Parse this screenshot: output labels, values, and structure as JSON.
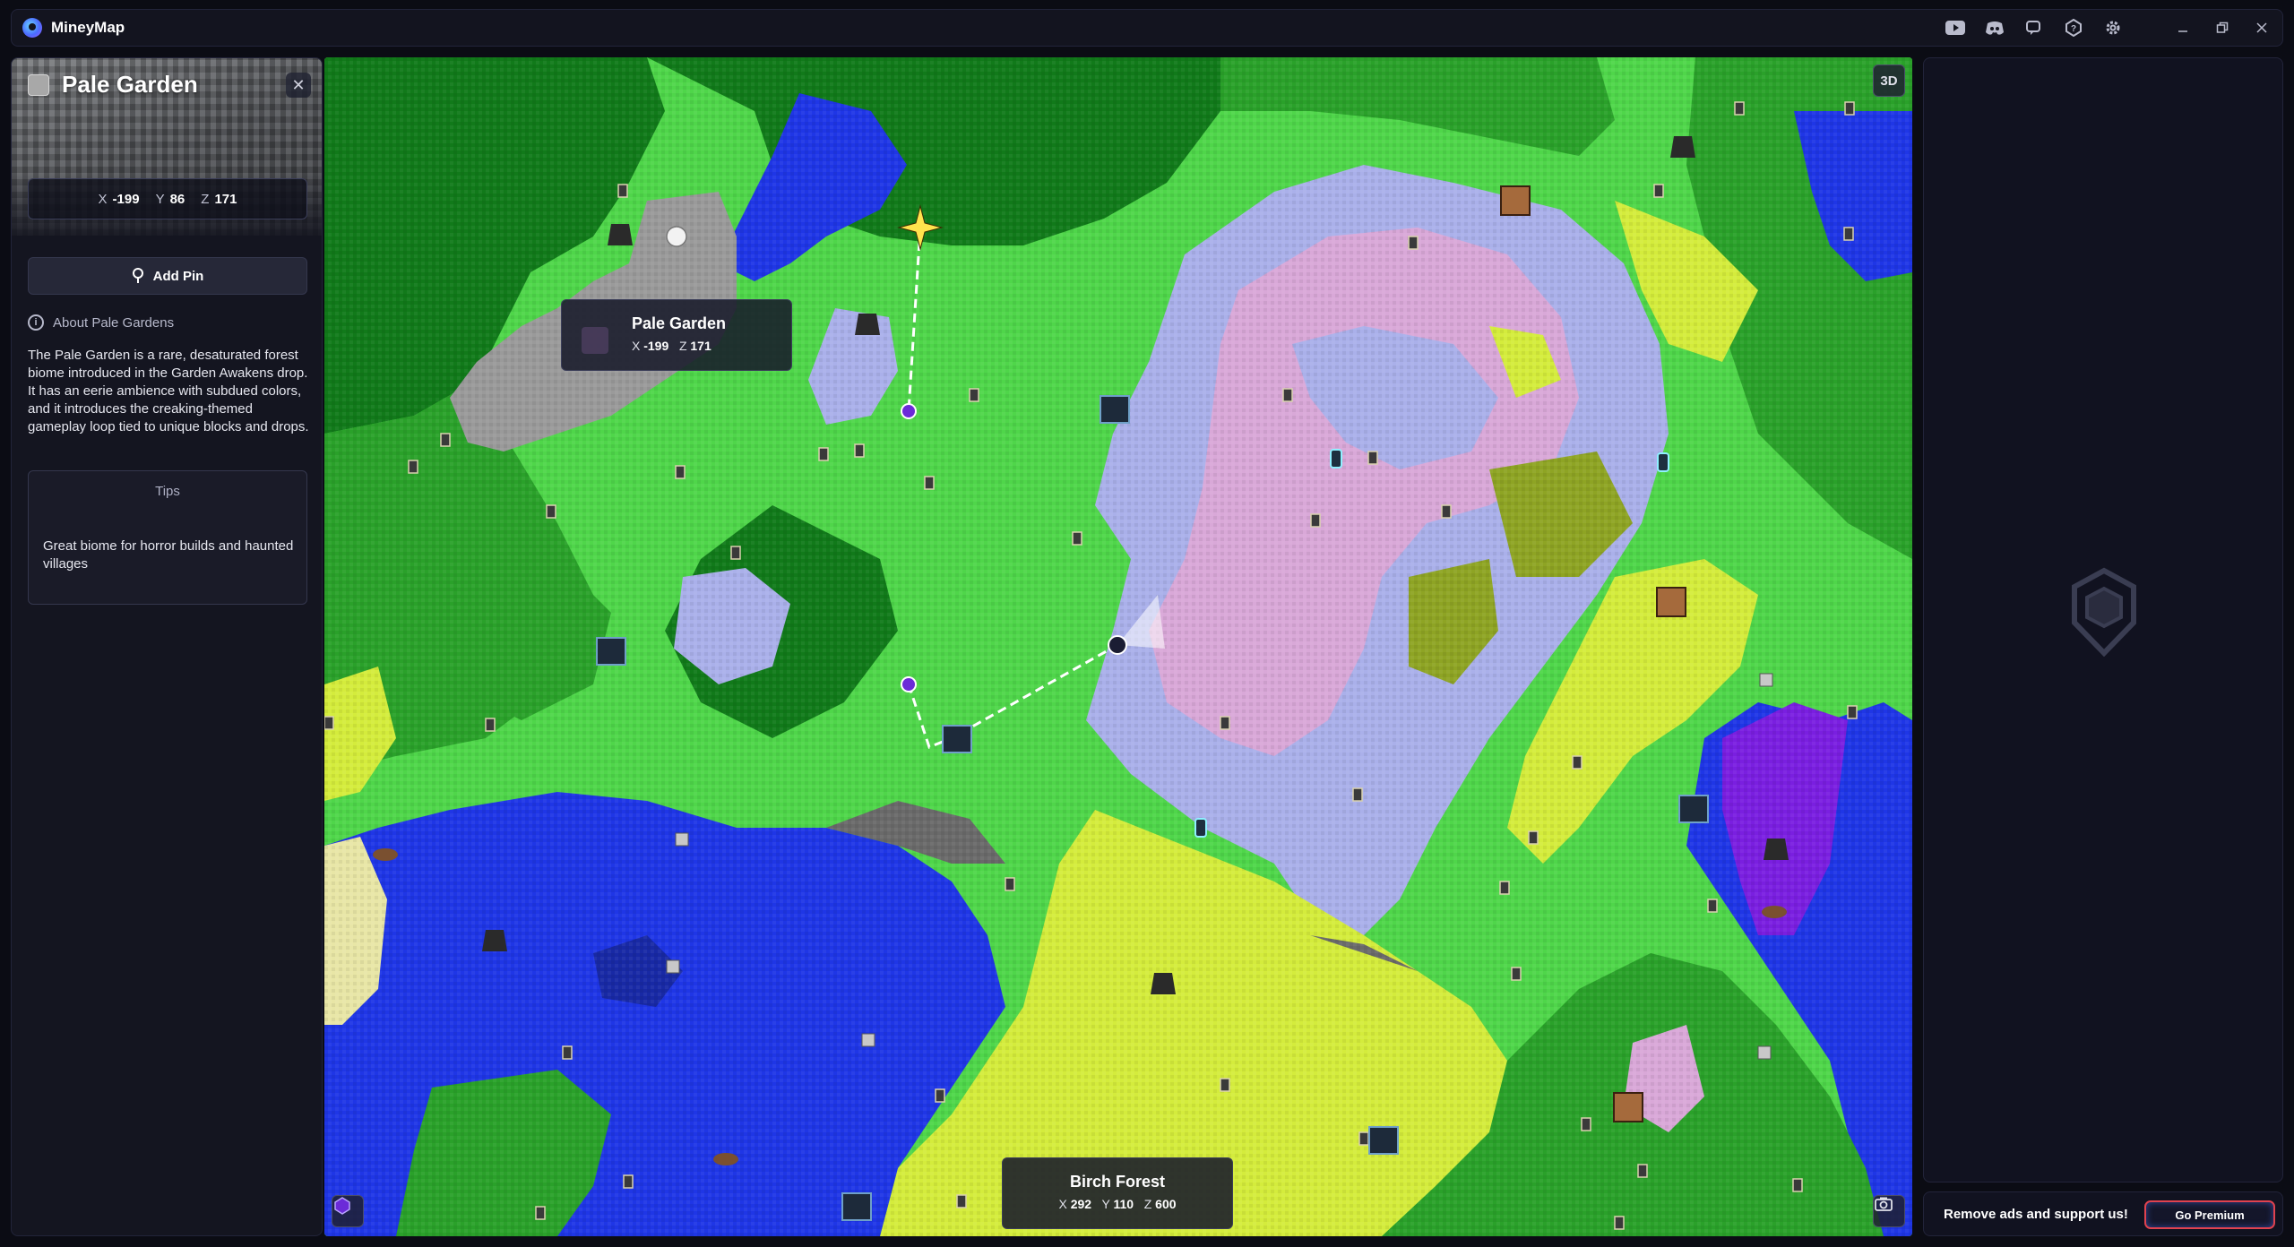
{
  "app": {
    "title": "MineyMap"
  },
  "titlebar_icons": [
    "youtube-icon",
    "discord-icon",
    "megaphone-icon",
    "help-icon",
    "settings-icon",
    "minimize-icon",
    "restore-icon",
    "close-icon"
  ],
  "panel": {
    "biome_name": "Pale Garden",
    "swatch_color": "#a8a8a8",
    "coords": {
      "x_label": "X",
      "x": "-199",
      "y_label": "Y",
      "y": "86",
      "z_label": "Z",
      "z": "171"
    },
    "add_pin_label": "Add Pin",
    "about_label": "About Pale Gardens",
    "description": "The Pale Garden is a rare, desaturated forest biome introduced in the Garden Awakens drop. It has an eerie ambience with subdued colors, and it introduces the creaking-themed gameplay loop tied to unique blocks and drops.",
    "tips_title": "Tips",
    "tips_text": "Great biome for horror builds and haunted villages"
  },
  "map": {
    "view_mode_label": "3D",
    "pin_tooltip": {
      "name": "Pale Garden",
      "x_label": "X",
      "x": "-199",
      "z_label": "Z",
      "z": "171"
    },
    "cursor_tooltip": {
      "name": "Birch Forest",
      "x_label": "X",
      "x": "292",
      "y_label": "Y",
      "y": "110",
      "z_label": "Z",
      "z": "600"
    },
    "biome_colors": {
      "ocean": "#1f36e6",
      "forest": "#2aa12a",
      "dark_forest": "#117a1a",
      "plains": "#4fd64a",
      "birch_forest": "#d4ec3c",
      "pale_garden": "#9a9a9a",
      "cherry_grove": "#d9a8d8",
      "meadow": "#aab0ea",
      "swamp": "#8ea424",
      "mushroom": "#7a1fe0",
      "beach": "#e8e6a6"
    }
  },
  "ad": {
    "promo_text": "Remove ads and support us!",
    "premium_button": "Go Premium"
  }
}
